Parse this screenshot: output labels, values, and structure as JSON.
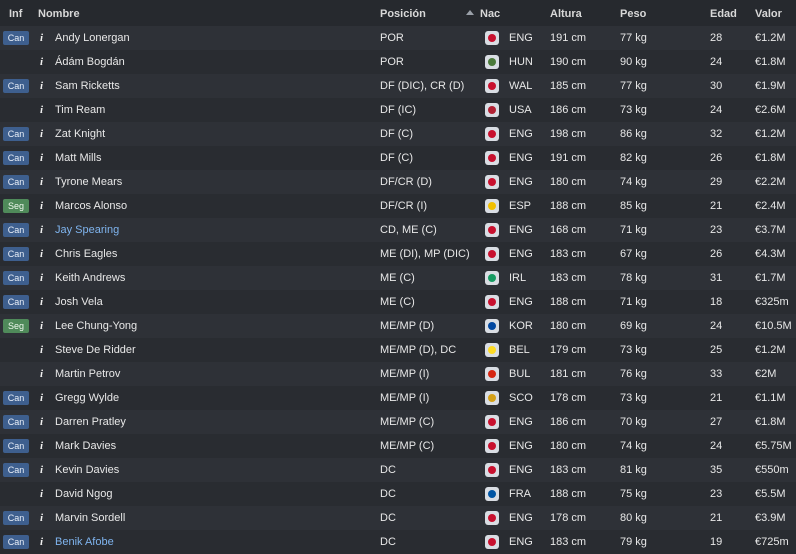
{
  "header": {
    "inf": "Inf",
    "nombre": "Nombre",
    "posicion": "Posición",
    "nac": "Nac",
    "altura": "Altura",
    "peso": "Peso",
    "edad": "Edad",
    "valor": "Valor"
  },
  "players": [
    {
      "inf": "Can",
      "name": "Andy Lonergan",
      "pos": "POR",
      "nat": "ENG",
      "height": "191 cm",
      "weight": "77 kg",
      "age": "28",
      "value": "€1.2M",
      "link": false,
      "flag_color": "#c8102e"
    },
    {
      "inf": "",
      "name": "Ádám Bogdán",
      "pos": "POR",
      "nat": "HUN",
      "height": "190 cm",
      "weight": "90 kg",
      "age": "24",
      "value": "€1.8M",
      "link": false,
      "flag_color": "#4a7a3a"
    },
    {
      "inf": "Can",
      "name": "Sam Ricketts",
      "pos": "DF (DIC), CR (D)",
      "nat": "WAL",
      "height": "185 cm",
      "weight": "77 kg",
      "age": "30",
      "value": "€1.9M",
      "link": false,
      "flag_color": "#c8102e"
    },
    {
      "inf": "",
      "name": "Tim Ream",
      "pos": "DF (IC)",
      "nat": "USA",
      "height": "186 cm",
      "weight": "73 kg",
      "age": "24",
      "value": "€2.6M",
      "link": false,
      "flag_color": "#b22234"
    },
    {
      "inf": "Can",
      "name": "Zat Knight",
      "pos": "DF (C)",
      "nat": "ENG",
      "height": "198 cm",
      "weight": "86 kg",
      "age": "32",
      "value": "€1.2M",
      "link": false,
      "flag_color": "#c8102e"
    },
    {
      "inf": "Can",
      "name": "Matt Mills",
      "pos": "DF (C)",
      "nat": "ENG",
      "height": "191 cm",
      "weight": "82 kg",
      "age": "26",
      "value": "€1.8M",
      "link": false,
      "flag_color": "#c8102e"
    },
    {
      "inf": "Can",
      "name": "Tyrone Mears",
      "pos": "DF/CR (D)",
      "nat": "ENG",
      "height": "180 cm",
      "weight": "74 kg",
      "age": "29",
      "value": "€2.2M",
      "link": false,
      "flag_color": "#c8102e"
    },
    {
      "inf": "Seg",
      "name": "Marcos Alonso",
      "pos": "DF/CR (I)",
      "nat": "ESP",
      "height": "188 cm",
      "weight": "85 kg",
      "age": "21",
      "value": "€2.4M",
      "link": false,
      "flag_color": "#f1bf00"
    },
    {
      "inf": "Can",
      "name": "Jay Spearing",
      "pos": "CD, ME (C)",
      "nat": "ENG",
      "height": "168 cm",
      "weight": "71 kg",
      "age": "23",
      "value": "€3.7M",
      "link": true,
      "flag_color": "#c8102e"
    },
    {
      "inf": "Can",
      "name": "Chris Eagles",
      "pos": "ME (DI), MP (DIC)",
      "nat": "ENG",
      "height": "183 cm",
      "weight": "67 kg",
      "age": "26",
      "value": "€4.3M",
      "link": false,
      "flag_color": "#c8102e"
    },
    {
      "inf": "Can",
      "name": "Keith Andrews",
      "pos": "ME (C)",
      "nat": "IRL",
      "height": "183 cm",
      "weight": "78 kg",
      "age": "31",
      "value": "€1.7M",
      "link": false,
      "flag_color": "#169b62"
    },
    {
      "inf": "Can",
      "name": "Josh Vela",
      "pos": "ME (C)",
      "nat": "ENG",
      "height": "188 cm",
      "weight": "71 kg",
      "age": "18",
      "value": "€325m",
      "link": false,
      "flag_color": "#c8102e"
    },
    {
      "inf": "Seg",
      "name": "Lee Chung-Yong",
      "pos": "ME/MP (D)",
      "nat": "KOR",
      "height": "180 cm",
      "weight": "69 kg",
      "age": "24",
      "value": "€10.5M",
      "link": false,
      "flag_color": "#0047a0"
    },
    {
      "inf": "",
      "name": "Steve De Ridder",
      "pos": "ME/MP (D), DC",
      "nat": "BEL",
      "height": "179 cm",
      "weight": "73 kg",
      "age": "25",
      "value": "€1.2M",
      "link": false,
      "flag_color": "#fdda24"
    },
    {
      "inf": "",
      "name": "Martin Petrov",
      "pos": "ME/MP (I)",
      "nat": "BUL",
      "height": "181 cm",
      "weight": "76 kg",
      "age": "33",
      "value": "€2M",
      "link": false,
      "flag_color": "#d62612"
    },
    {
      "inf": "Can",
      "name": "Gregg Wylde",
      "pos": "ME/MP (I)",
      "nat": "SCO",
      "height": "178 cm",
      "weight": "73 kg",
      "age": "21",
      "value": "€1.1M",
      "link": false,
      "flag_color": "#d4a017"
    },
    {
      "inf": "Can",
      "name": "Darren Pratley",
      "pos": "ME/MP (C)",
      "nat": "ENG",
      "height": "186 cm",
      "weight": "70 kg",
      "age": "27",
      "value": "€1.8M",
      "link": false,
      "flag_color": "#c8102e"
    },
    {
      "inf": "Can",
      "name": "Mark Davies",
      "pos": "ME/MP (C)",
      "nat": "ENG",
      "height": "180 cm",
      "weight": "74 kg",
      "age": "24",
      "value": "€5.75M",
      "link": false,
      "flag_color": "#c8102e"
    },
    {
      "inf": "Can",
      "name": "Kevin Davies",
      "pos": "DC",
      "nat": "ENG",
      "height": "183 cm",
      "weight": "81 kg",
      "age": "35",
      "value": "€550m",
      "link": false,
      "flag_color": "#c8102e"
    },
    {
      "inf": "",
      "name": "David Ngog",
      "pos": "DC",
      "nat": "FRA",
      "height": "188 cm",
      "weight": "75 kg",
      "age": "23",
      "value": "€5.5M",
      "link": false,
      "flag_color": "#0055a4"
    },
    {
      "inf": "Can",
      "name": "Marvin Sordell",
      "pos": "DC",
      "nat": "ENG",
      "height": "178 cm",
      "weight": "80 kg",
      "age": "21",
      "value": "€3.9M",
      "link": false,
      "flag_color": "#c8102e"
    },
    {
      "inf": "Can",
      "name": "Benik Afobe",
      "pos": "DC",
      "nat": "ENG",
      "height": "183 cm",
      "weight": "79 kg",
      "age": "19",
      "value": "€725m",
      "link": true,
      "flag_color": "#c8102e"
    }
  ]
}
